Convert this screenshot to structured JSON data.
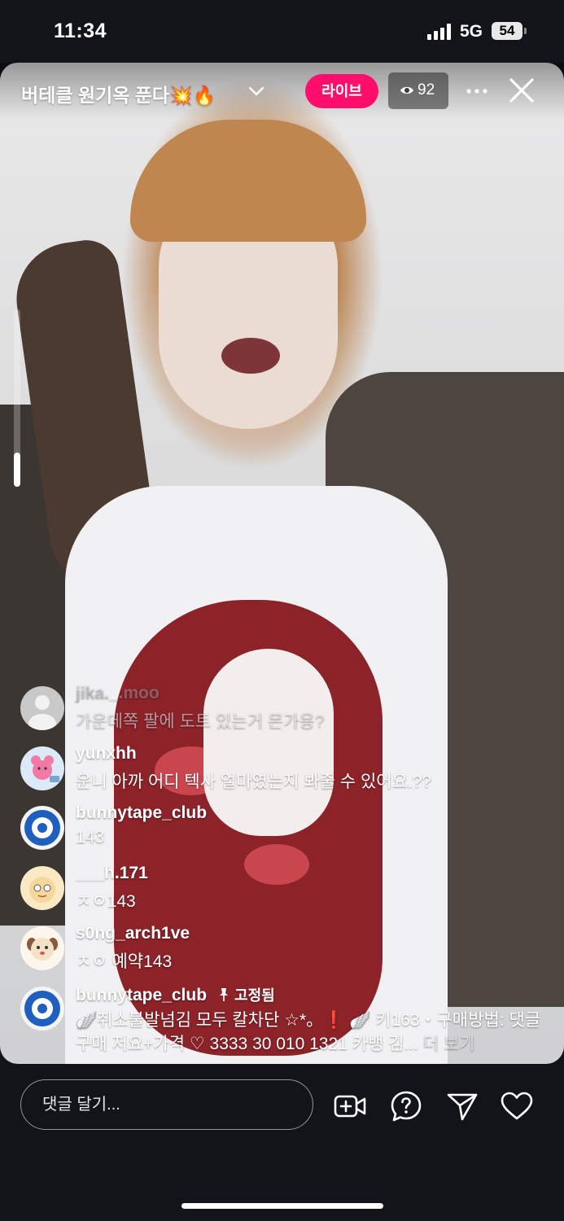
{
  "status": {
    "time": "11:34",
    "network": "5G",
    "battery": "54"
  },
  "live": {
    "title": "버테클 원기옥 푼다💥🔥",
    "badge": "라이브",
    "viewers": "92"
  },
  "comments": [
    {
      "user": "jika._.moo",
      "text": "가운데쪽 팔에 도트 있는거 몬가용?",
      "avatar": "grey-default"
    },
    {
      "user": "yunxhh",
      "text": "운니 아까 어디 텍사 얼마였는지 봐줄 수 있어요.??",
      "avatar": "pink-bear"
    },
    {
      "user": "bunnytape_club",
      "text": "143",
      "avatar": "funny-tape-club"
    },
    {
      "user": "___h.171",
      "text": "ㅈㅇ143",
      "avatar": "cartoon-face"
    },
    {
      "user": "s0ng_arch1ve",
      "text": "ㅈㅇ 예약143",
      "avatar": "puppy"
    }
  ],
  "pinned": {
    "user": "bunnytape_club",
    "label": "고정됨",
    "text": "🪽취소불발넘김 모두 칼차단 ☆*。❗ 🪽 키163・구매방법: 댓글구매 저요+가격 ♡ 3333 30 010 1321 카뱅 김...",
    "more": "더 보기"
  },
  "input": {
    "placeholder": "댓글 달기..."
  },
  "actions": [
    "add-video-icon",
    "question-icon",
    "send-icon",
    "heart-icon"
  ]
}
